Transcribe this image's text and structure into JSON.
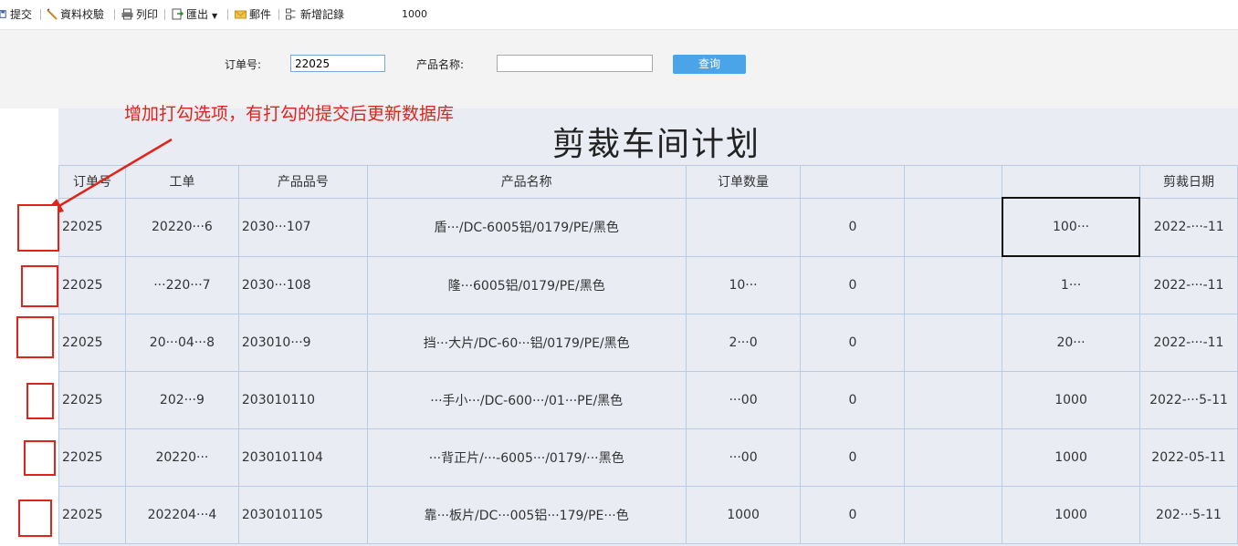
{
  "toolbar": {
    "submit": "提交",
    "validate": "資料校驗",
    "print": "列印",
    "export": "匯出",
    "mail": "郵件",
    "new_record": "新增記錄",
    "number": "1000"
  },
  "filter": {
    "order_label": "订单号:",
    "order_value": "22025",
    "product_label": "产品名称:",
    "product_value": "",
    "query_button": "查询"
  },
  "annotation": {
    "text": "增加打勾选项，有打勾的提交后更新数据库"
  },
  "report": {
    "title": "剪裁车间计划",
    "columns": [
      "订单号",
      "工单",
      "产品品号",
      "产品名称",
      "订单数量",
      "",
      "",
      "",
      "剪裁日期"
    ],
    "rows": [
      [
        "22025",
        "20220···6",
        "2030···107",
        "盾···/DC-6005铝/0179/PE/黑色",
        "",
        "0",
        "",
        "100···",
        "2022-···-11"
      ],
      [
        "22025",
        "···220···7",
        "2030···108",
        "隆···6005铝/0179/PE/黑色",
        "10···",
        "0",
        "",
        "1···",
        "2022-···-11"
      ],
      [
        "22025",
        "20···04···8",
        "203010···9",
        "挡···大片/DC-60···铝/0179/PE/黑色",
        "2···0",
        "0",
        "",
        "20···",
        "2022-···-11"
      ],
      [
        "22025",
        "202···9",
        "203010110",
        "···手小···/DC-600···/01···PE/黑色",
        "···00",
        "0",
        "",
        "1000",
        "2022-···5-11"
      ],
      [
        "22025",
        "20220···",
        "2030101104",
        "···背正片/···-6005···/0179/···黑色",
        "···00",
        "0",
        "",
        "1000",
        "2022-05-11"
      ],
      [
        "22025",
        "202204···4",
        "2030101105",
        "靠···板片/DC···005铝···179/PE···色",
        "1000",
        "0",
        "",
        "1000",
        "202···5-11"
      ]
    ]
  },
  "colors": {
    "accent": "#4ca4e8",
    "annotation": "#e0241b",
    "grid_border": "#b8cce4",
    "report_bg": "#e9ecf3"
  }
}
